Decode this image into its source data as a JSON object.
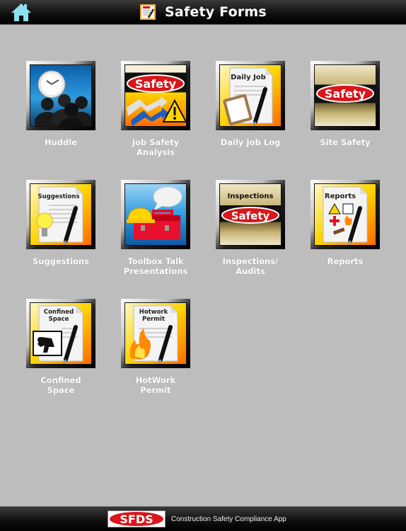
{
  "header": {
    "title": "Safety Forms",
    "home_icon": "home-icon",
    "title_icon": "form-clipboard-icon"
  },
  "tiles": [
    {
      "label": "Huddle",
      "icon": "huddle-clock-people-icon"
    },
    {
      "label": "Job Safety Analysis",
      "icon": "job-safety-analysis-icon",
      "badge": "Safety"
    },
    {
      "label": "Daily Job Log",
      "icon": "daily-job-log-icon",
      "badge": "Daily Job"
    },
    {
      "label": "Site Safety",
      "icon": "site-safety-icon",
      "badge": "Safety"
    },
    {
      "label": "Suggestions",
      "icon": "suggestions-icon",
      "badge": "Suggestions"
    },
    {
      "label": "Toolbox Talk Presentations",
      "icon": "toolbox-talk-icon"
    },
    {
      "label": "Inspections/ Audits",
      "icon": "inspections-icon",
      "badge": "Inspections",
      "badge2": "Safety"
    },
    {
      "label": "Reports",
      "icon": "reports-icon",
      "badge": "Reports"
    },
    {
      "label": "Confined Space",
      "icon": "confined-space-icon",
      "badge": "Confined",
      "badge2": "Space"
    },
    {
      "label": "HotWork Permit",
      "icon": "hotwork-permit-icon",
      "badge": "Hotwork",
      "badge2": "Permit"
    }
  ],
  "footer": {
    "logo_text": "SFDS",
    "tagline": "Construction Safety Compliance App"
  },
  "colors": {
    "background": "#bdbdbd",
    "home_icon": "#8ee0ee",
    "safety_red": "#d8161b"
  }
}
